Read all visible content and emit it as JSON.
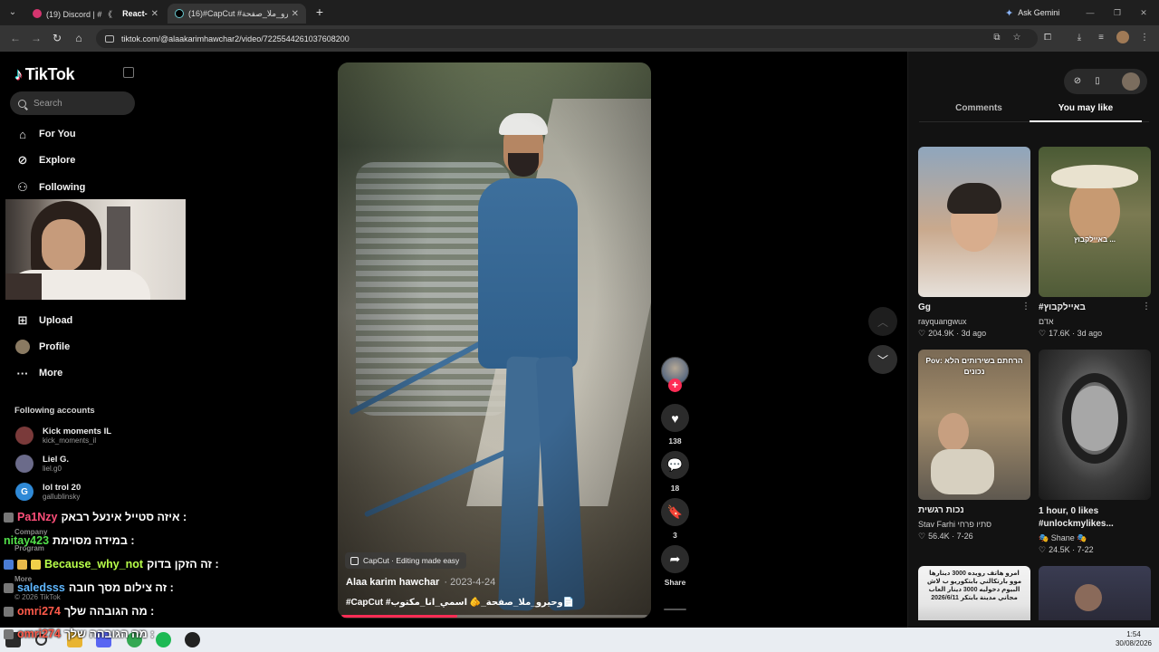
{
  "browser": {
    "tabs": [
      {
        "title": "(19) Discord | # 《",
        "subtitle": "React-",
        "active": false
      },
      {
        "title": "(16)#CapCut #وحيرو_ملا_صفحة_",
        "active": true
      }
    ],
    "gemini_label": "Ask Gemini",
    "url": "tiktok.com/@alaakarimhawchar2/video/7225544261037608200"
  },
  "tiktok": {
    "brand": "TikTok",
    "search_placeholder": "Search",
    "nav": [
      {
        "label": "For You",
        "icon": "home-icon"
      },
      {
        "label": "Explore",
        "icon": "compass-icon"
      },
      {
        "label": "Following",
        "icon": "following-icon"
      },
      {
        "label": "Upload",
        "icon": "plus-square-icon"
      },
      {
        "label": "Profile",
        "icon": "profile-avatar-icon"
      },
      {
        "label": "More",
        "icon": "more-dots-icon"
      }
    ],
    "following_title": "Following accounts",
    "following_accounts": [
      {
        "name": "Kick moments IL",
        "handle": "kick_moments_il",
        "color": "#7a3a3a",
        "initial": ""
      },
      {
        "name": "Liel G.",
        "handle": "liel.g0",
        "color": "#6b6b8a",
        "initial": ""
      },
      {
        "name": "lol trol 20",
        "handle": "gallublinsky",
        "color": "#2f89d6",
        "initial": "G"
      }
    ],
    "footer": {
      "company": "Company",
      "program": "Program",
      "more": "More",
      "copyright": "© 2026 TikTok"
    }
  },
  "chat_overlay": [
    {
      "user": "Pa1Nzy",
      "message": "איזה סטייל אינעל רבאק :",
      "color": "#ff4f7a"
    },
    {
      "user": "nitay423",
      "message": "במידה מסוימת :",
      "color": "#52e04a"
    },
    {
      "user": "Because_why_not",
      "message": "זה הזקן בדוק :",
      "color": "#b8ff4a"
    },
    {
      "user": "saledsss",
      "message": "זה צילום מסך חובה :",
      "color": "#5fb7ff"
    },
    {
      "user": "omri274",
      "message": "מה הגובהה שלך :",
      "color": "#ff5a4a"
    },
    {
      "user": "omri274",
      "message": "מה הגובהה שלך :",
      "color": "#ff5a4a"
    }
  ],
  "video": {
    "effect_tag": "CapCut · Editing made easy",
    "author": "Alaa karim hawchar",
    "date": "· 2023-4-24",
    "caption": "#CapCut #وحيرو_ملا_صفحة_🫵 اسمي_انا_مكتوب📄",
    "progress": 0.38,
    "likes": "138",
    "comments": "18",
    "saves": "3",
    "share_label": "Share"
  },
  "panel": {
    "tabs": [
      "Comments",
      "You may like"
    ],
    "active_tab": "You may like",
    "cards": [
      {
        "title": "Gg",
        "user": "rayquangwux",
        "likes": "204.9K",
        "age": "3d ago",
        "thumb_text": ""
      },
      {
        "title": "#באיילקבוץ",
        "user": "אדם",
        "likes": "17.6K",
        "age": "3d ago",
        "thumb_text": "באיילקבוץ ..."
      },
      {
        "title": "נכות רגשית",
        "user": "Stav Farhi סתיו פרחי",
        "likes": "56.4K",
        "age": "7-26",
        "thumb_text": "Pov: הרחתם בשירותים הלא נכונים"
      },
      {
        "title": "1 hour, 0 likes #unlockmylikes...",
        "user": "🎭 Shane 🎭",
        "likes": "24.5K",
        "age": "7-22",
        "thumb_text": ""
      },
      {
        "title": "",
        "user": "",
        "likes": "",
        "age": "",
        "thumb_text": "امرو هاتف رويده 3000 دينارها موو بارتكالني بابتكوريو ب لاش البيوم دخوليه 3000 دينار العاب مجاني مدينة بابتكر 2026/6/11"
      },
      {
        "title": "",
        "user": "",
        "likes": "",
        "age": "",
        "thumb_text": ""
      }
    ]
  },
  "taskbar": {
    "time": "1:54",
    "date": "30/08/2026"
  }
}
